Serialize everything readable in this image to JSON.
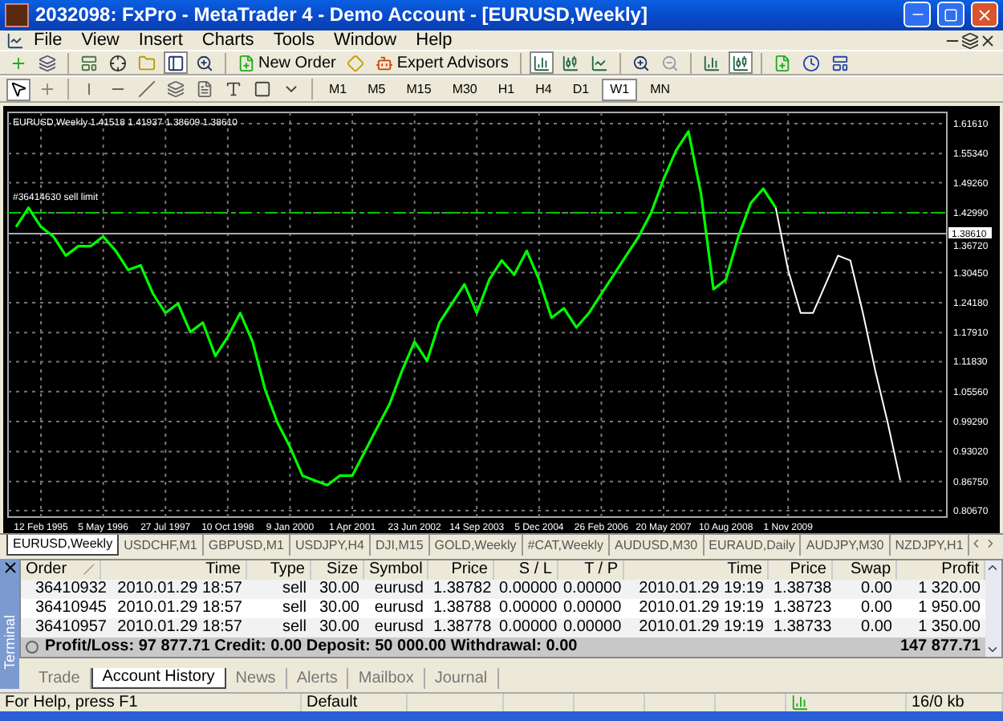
{
  "window": {
    "title": "2032098: FxPro - MetaTrader 4 - Demo Account - [EURUSD,Weekly]"
  },
  "menu": [
    "File",
    "View",
    "Insert",
    "Charts",
    "Tools",
    "Window",
    "Help"
  ],
  "toolbar": {
    "buttons": [
      {
        "label": "New Order"
      },
      {
        "label": "Expert Advisors"
      }
    ]
  },
  "timeframes": [
    {
      "label": "M1",
      "selected": false
    },
    {
      "label": "M5",
      "selected": false
    },
    {
      "label": "M15",
      "selected": false
    },
    {
      "label": "M30",
      "selected": false
    },
    {
      "label": "H1",
      "selected": false
    },
    {
      "label": "H4",
      "selected": false
    },
    {
      "label": "D1",
      "selected": false
    },
    {
      "label": "W1",
      "selected": true
    },
    {
      "label": "MN",
      "selected": false
    }
  ],
  "chart": {
    "chart_data": {
      "type": "line",
      "grid": true,
      "ref_lines": [
        {
          "axis": "y",
          "value": 1.4299,
          "label": "#36414630 sell limit",
          "color": "#00c800"
        },
        {
          "axis": "y",
          "value": 1.3861,
          "label": "1.38610",
          "color": "#aaaaaa"
        }
      ],
      "title": "EURUSD,Weekly  1.41518 1.41937 1.38609 1.38610",
      "categories": [
        null,
        null,
        "12 Feb 1995",
        null,
        null,
        null,
        null,
        "5 May 1996",
        null,
        null,
        null,
        null,
        "27 Jul 1997",
        null,
        null,
        null,
        null,
        "10 Oct 1998",
        null,
        null,
        null,
        null,
        "9 Jan 2000",
        null,
        null,
        null,
        null,
        "1 Apr 2001",
        null,
        null,
        null,
        null,
        "23 Jun 2002",
        null,
        null,
        null,
        null,
        "14 Sep 2003",
        null,
        null,
        null,
        null,
        "5 Dec 2004",
        null,
        null,
        null,
        null,
        "26 Feb 2006",
        null,
        null,
        null,
        null,
        "20 May 2007",
        null,
        null,
        null,
        null,
        "10 Aug 2008",
        null,
        null,
        null,
        null,
        "1 Nov 2009",
        null,
        null,
        null,
        null,
        null,
        null,
        null,
        null,
        null
      ],
      "series": [
        {
          "color": "#00ff00",
          "values": [
            1.4,
            1.44,
            1.4,
            1.38,
            1.34,
            1.36,
            1.36,
            1.38,
            1.35,
            1.31,
            1.32,
            1.26,
            1.22,
            1.24,
            1.18,
            1.2,
            1.13,
            1.17,
            1.22,
            1.16,
            1.06,
            0.99,
            0.94,
            0.88,
            0.87,
            0.86,
            0.88,
            0.88,
            0.93,
            0.98,
            1.03,
            1.1,
            1.16,
            1.12,
            1.2,
            1.24,
            1.28,
            1.22,
            1.29,
            1.33,
            1.3,
            1.35,
            1.29,
            1.21,
            1.23,
            1.19,
            1.22,
            1.26,
            1.3,
            1.34,
            1.38,
            1.43,
            1.5,
            1.56,
            1.6,
            1.47,
            1.27,
            1.29,
            1.38,
            1.45,
            1.48,
            1.44,
            null,
            null,
            null,
            null,
            null,
            null,
            null,
            null,
            null,
            null
          ]
        },
        {
          "color": "#ffffff",
          "values": [
            null,
            null,
            null,
            null,
            null,
            null,
            null,
            null,
            null,
            null,
            null,
            null,
            null,
            null,
            null,
            null,
            null,
            null,
            null,
            null,
            null,
            null,
            null,
            null,
            null,
            null,
            null,
            null,
            null,
            null,
            null,
            null,
            null,
            null,
            null,
            null,
            null,
            null,
            null,
            null,
            null,
            null,
            null,
            null,
            null,
            null,
            null,
            null,
            null,
            null,
            null,
            null,
            null,
            null,
            null,
            null,
            null,
            null,
            null,
            null,
            null,
            1.44,
            1.31,
            1.22,
            1.22,
            1.28,
            1.34,
            1.33,
            1.22,
            1.1,
            0.99,
            0.87
          ]
        }
      ],
      "ylim": [
        0.8067,
        1.6161
      ],
      "yticks": [
        {
          "value": 1.6161,
          "label": "1.61610"
        },
        {
          "value": 1.5534,
          "label": "1.55340"
        },
        {
          "value": 1.4926,
          "label": "1.49260"
        },
        {
          "value": 1.4299,
          "label": "1.42990"
        },
        {
          "value": 1.3672,
          "label": "1.36720"
        },
        {
          "value": 1.3045,
          "label": "1.30450"
        },
        {
          "value": 1.2418,
          "label": "1.24180"
        },
        {
          "value": 1.1791,
          "label": "1.17910"
        },
        {
          "value": 1.1183,
          "label": "1.11830"
        },
        {
          "value": 1.0556,
          "label": "1.05560"
        },
        {
          "value": 0.9929,
          "label": "0.99290"
        },
        {
          "value": 0.9302,
          "label": "0.93020"
        },
        {
          "value": 0.8675,
          "label": "0.86750"
        },
        {
          "value": 0.8067,
          "label": "0.80670"
        }
      ]
    }
  },
  "chart_tabs": [
    {
      "label": "EURUSD,Weekly",
      "selected": true
    },
    {
      "label": "USDCHF,M1",
      "selected": false
    },
    {
      "label": "GBPUSD,M1",
      "selected": false
    },
    {
      "label": "USDJPY,H4",
      "selected": false
    },
    {
      "label": "DJI,M15",
      "selected": false
    },
    {
      "label": "GOLD,Weekly",
      "selected": false
    },
    {
      "label": "#CAT,Weekly",
      "selected": false
    },
    {
      "label": "AUDUSD,M30",
      "selected": false
    },
    {
      "label": "EURAUD,Daily",
      "selected": false
    },
    {
      "label": "AUDJPY,M30",
      "selected": false
    },
    {
      "label": "NZDJPY,H1",
      "selected": false
    }
  ],
  "terminal": {
    "side_label": "Terminal",
    "columns": [
      "Order",
      "Time",
      "Type",
      "Size",
      "Symbol",
      "Price",
      "S / L",
      "T / P",
      "Time",
      "Price",
      "Swap",
      "Profit"
    ],
    "rows": [
      [
        "36410932",
        "2010.01.29 18:57",
        "sell",
        "30.00",
        "eurusd",
        "1.38782",
        "0.00000",
        "0.00000",
        "2010.01.29 19:19",
        "1.38738",
        "0.00",
        "1 320.00"
      ],
      [
        "36410945",
        "2010.01.29 18:57",
        "sell",
        "30.00",
        "eurusd",
        "1.38788",
        "0.00000",
        "0.00000",
        "2010.01.29 19:19",
        "1.38723",
        "0.00",
        "1 950.00"
      ],
      [
        "36410957",
        "2010.01.29 18:57",
        "sell",
        "30.00",
        "eurusd",
        "1.38778",
        "0.00000",
        "0.00000",
        "2010.01.29 19:19",
        "1.38733",
        "0.00",
        "1 350.00"
      ]
    ],
    "summary": {
      "text": "Profit/Loss: 97 877.71  Credit: 0.00  Deposit: 50 000.00  Withdrawal: 0.00",
      "total": "147 877.71"
    },
    "tabs": [
      {
        "label": "Trade",
        "selected": false
      },
      {
        "label": "Account History",
        "selected": true
      },
      {
        "label": "News",
        "selected": false
      },
      {
        "label": "Alerts",
        "selected": false
      },
      {
        "label": "Mailbox",
        "selected": false
      },
      {
        "label": "Journal",
        "selected": false
      }
    ]
  },
  "status_bar": {
    "help": "For Help, press F1",
    "profile": "Default",
    "traffic": "16/0 kb"
  }
}
